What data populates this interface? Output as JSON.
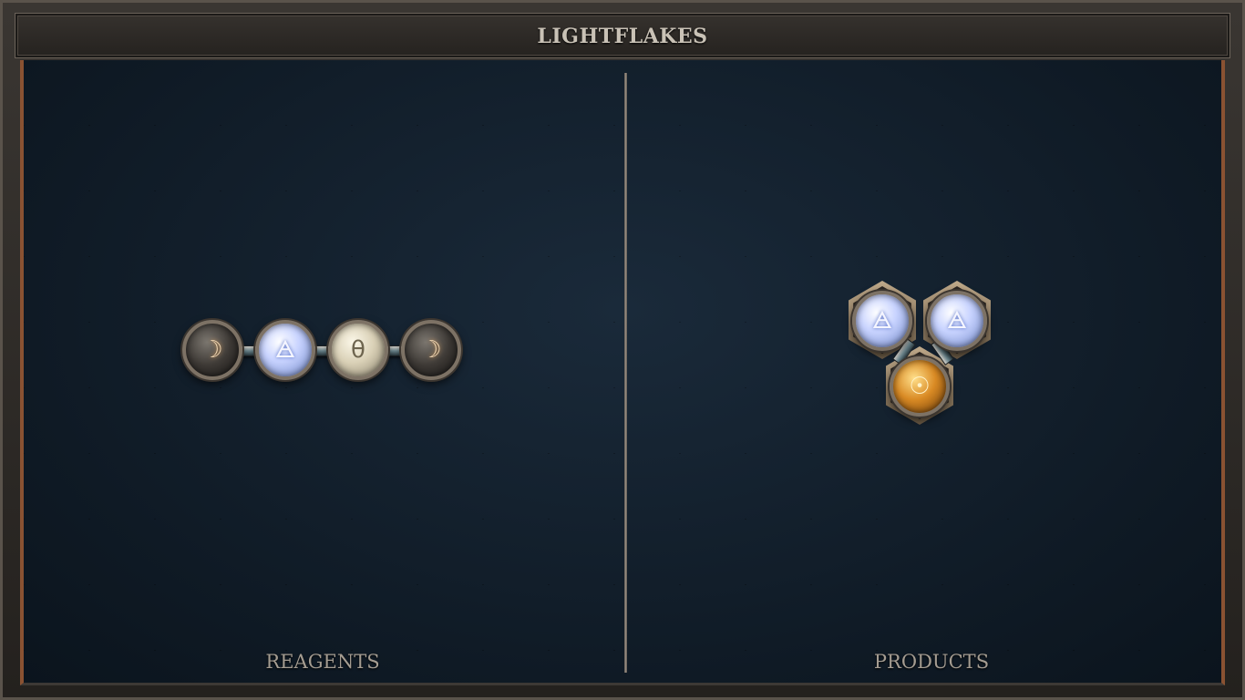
{
  "window": {
    "title": "LIGHTFLAKES"
  },
  "panels": {
    "reagents_label": "REAGENTS",
    "products_label": "PRODUCTS"
  },
  "reagents": [
    {
      "element": "quicksilver",
      "symbol": "☽"
    },
    {
      "element": "air",
      "symbol": "🜁"
    },
    {
      "element": "salt",
      "symbol": "θ"
    },
    {
      "element": "quicksilver",
      "symbol": "☽"
    }
  ],
  "products": [
    {
      "element": "air",
      "symbol": "🜁"
    },
    {
      "element": "air",
      "symbol": "🜁"
    },
    {
      "element": "gold",
      "symbol": "☉"
    }
  ],
  "colors": {
    "frame": "#3a3632",
    "board": "#13202d",
    "copper_edge": "#8a5232",
    "title_text": "#c9c2b6",
    "label_text": "#a49c91"
  }
}
